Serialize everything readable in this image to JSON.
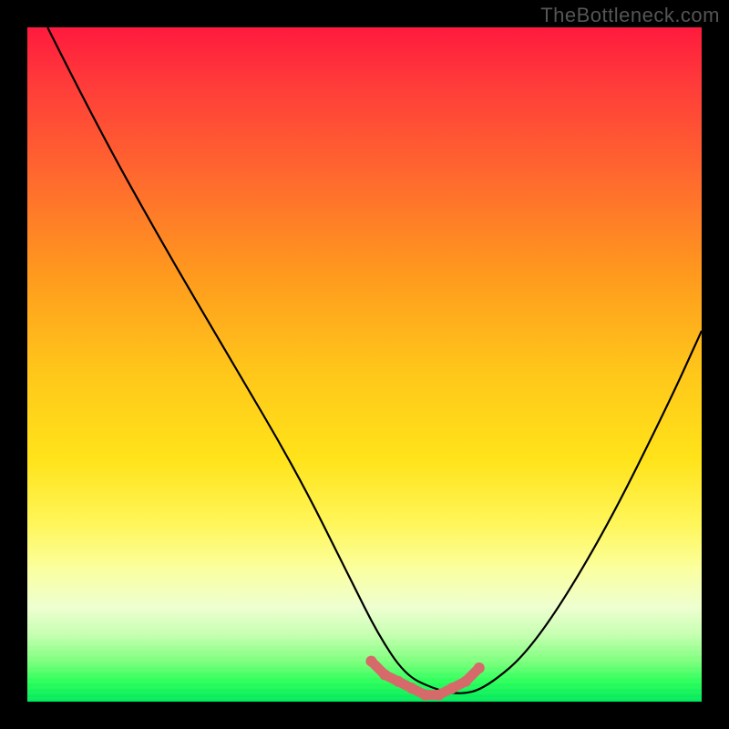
{
  "watermark": {
    "text": "TheBottleneck.com"
  },
  "chart_data": {
    "type": "line",
    "title": "",
    "xlabel": "",
    "ylabel": "",
    "xlim": [
      0,
      100
    ],
    "ylim": [
      0,
      100
    ],
    "grid": false,
    "legend": false,
    "background_gradient": {
      "direction": "vertical",
      "stops": [
        {
          "pos": 0.0,
          "color": "#ff1a3e"
        },
        {
          "pos": 0.22,
          "color": "#ff6a2e"
        },
        {
          "pos": 0.5,
          "color": "#ffc71a"
        },
        {
          "pos": 0.72,
          "color": "#fff65a"
        },
        {
          "pos": 0.86,
          "color": "#eeffd0"
        },
        {
          "pos": 0.94,
          "color": "#7dff7d"
        },
        {
          "pos": 1.0,
          "color": "#00e85c"
        }
      ]
    },
    "series": [
      {
        "name": "bottleneck-curve",
        "color": "#000000",
        "x": [
          3,
          10,
          20,
          30,
          40,
          48,
          52,
          56,
          60,
          64,
          68,
          75,
          85,
          95,
          100
        ],
        "y": [
          100,
          86,
          68,
          51,
          34,
          18,
          10,
          4,
          2,
          1,
          2,
          8,
          24,
          44,
          55
        ]
      }
    ],
    "markers": {
      "name": "optimal-range",
      "color": "#d66a6a",
      "shape": "circle",
      "radius_px": 6,
      "x": [
        51,
        53,
        55,
        57,
        59,
        61,
        63,
        65,
        67
      ],
      "y": [
        6,
        4,
        3,
        2,
        1,
        1,
        2,
        3,
        5
      ]
    }
  }
}
